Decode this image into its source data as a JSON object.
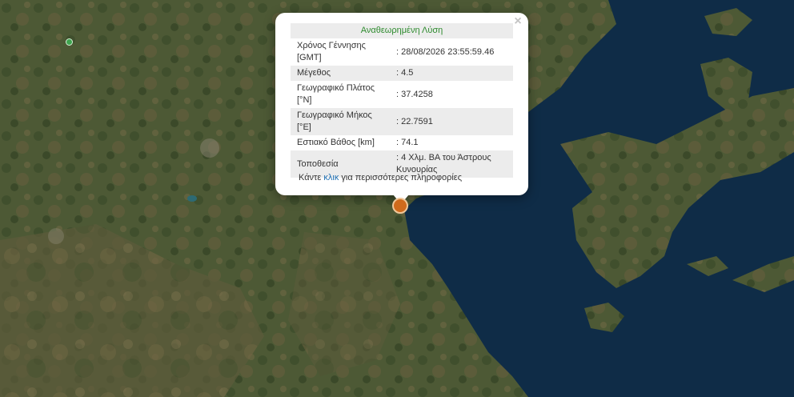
{
  "popup": {
    "header": "Αναθεωρημένη Λύση",
    "rows": [
      {
        "label": "Χρόνος Γέννησης [GMT]",
        "value": ": 28/08/2026 23:55:59.46"
      },
      {
        "label": "Μέγεθος",
        "value": ": 4.5"
      },
      {
        "label": "Γεωγραφικό Πλάτος [°N]",
        "value": ": 37.4258"
      },
      {
        "label": "Γεωγραφικό Μήκος [°E]",
        "value": ": 22.7591"
      },
      {
        "label": "Εστιακό Βάθος [km]",
        "value": ": 74.1"
      },
      {
        "label": "Τοποθεσία",
        "value": ": 4 Χλμ. ΒΑ του Άστρους Κυνουρίας"
      }
    ],
    "more_prefix": "Κάντε",
    "more_link": "κλικ",
    "more_suffix": "για περισσότερες πληροφορίες",
    "close_label": "×"
  },
  "colors": {
    "header_green": "#2e8b2e",
    "link_blue": "#1f6fb2",
    "quake_marker": "#cf6a1c",
    "station_marker": "#3fa44f",
    "sea": "#0f2c47",
    "land": "#4b5733"
  },
  "icons": {
    "quake": "earthquake-marker-icon",
    "station": "station-marker-icon",
    "close": "close-icon"
  }
}
